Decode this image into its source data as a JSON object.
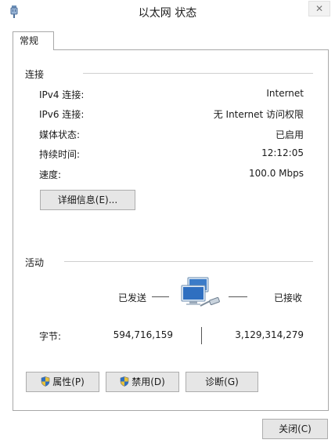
{
  "window": {
    "title": "以太网 状态",
    "close_glyph": "✕"
  },
  "tab": {
    "label": "常规"
  },
  "connection": {
    "title": "连接",
    "rows": [
      {
        "label": "IPv4 连接:",
        "value": "Internet"
      },
      {
        "label": "IPv6 连接:",
        "value": "无 Internet 访问权限"
      },
      {
        "label": "媒体状态:",
        "value": "已启用"
      },
      {
        "label": "持续时间:",
        "value": "12:12:05"
      },
      {
        "label": "速度:",
        "value": "100.0 Mbps"
      }
    ],
    "details_button": "详细信息(E)..."
  },
  "activity": {
    "title": "活动",
    "sent_label": "已发送",
    "received_label": "已接收",
    "bytes_label": "字节:",
    "bytes_sent": "594,716,159",
    "bytes_received": "3,129,314,279"
  },
  "buttons": {
    "properties": "属性(P)",
    "disable": "禁用(D)",
    "diagnose": "诊断(G)",
    "close": "关闭(C)"
  },
  "icons": {
    "window": "network-adapter-icon",
    "activity": "network-computers-icon",
    "shield": "uac-shield-icon"
  }
}
